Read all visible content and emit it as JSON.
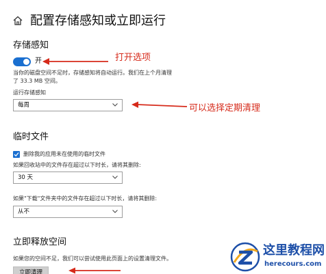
{
  "header": {
    "home_icon": "home-icon",
    "title": "配置存储感知或立即运行"
  },
  "storage_sense": {
    "heading": "存储感知",
    "toggle_on": true,
    "toggle_label": "开",
    "description_line1": "当你的磁盘空间不足时，存储感知将自动运行。我们在上个月清理",
    "description_line2": "了 33.3 MB 空间。",
    "run_label": "运行存储感知",
    "run_value": "每周"
  },
  "temp_files": {
    "heading": "临时文件",
    "checkbox_checked": true,
    "checkbox_label": "删除我的应用未在使用的临时文件",
    "recycle_label": "如果回收站中的文件存在超过以下时长，请将其删除:",
    "recycle_value": "30 天",
    "downloads_label": "如果\"下载\"文件夹中的文件存在超过以下时长，请将其删除:",
    "downloads_value": "从不"
  },
  "free_now": {
    "heading": "立即释放空间",
    "description": "如果您的空间不足，我们可以尝试使用此页面上的设置清理文件。",
    "button_label": "立即清理"
  },
  "annotations": {
    "open_option": "打开选项",
    "schedule": "可以选择定期清理",
    "color": "#d62a1a"
  },
  "watermark": {
    "title": "这里教程网",
    "url": "herecours.com"
  },
  "colors": {
    "accent": "#1a6fd0",
    "annotation": "#d62a1a",
    "watermark": "#1d4fa8"
  }
}
